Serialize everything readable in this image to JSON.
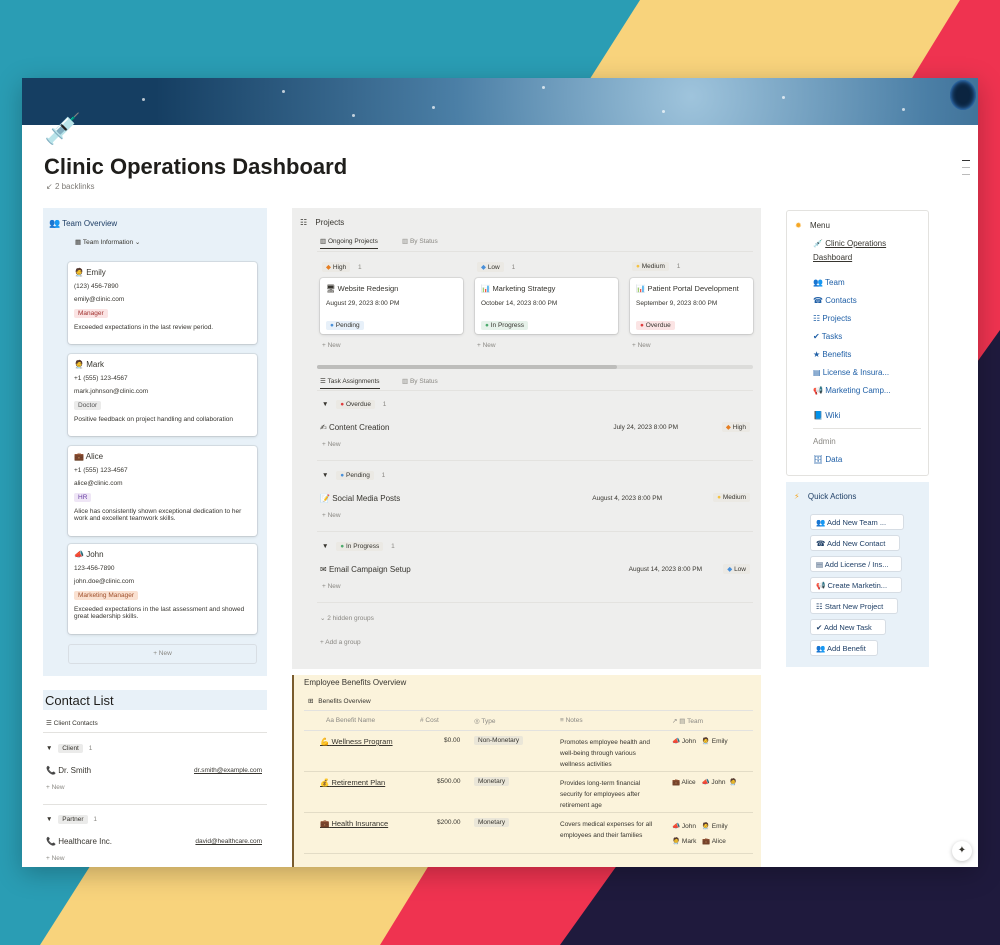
{
  "page": {
    "icon": "syringe",
    "title": "Clinic Operations Dashboard",
    "backlinks": "2 backlinks"
  },
  "team": {
    "header": "Team Overview",
    "view": "Team Information",
    "members": [
      {
        "name": "Emily",
        "phone": "(123) 456-7890",
        "email": "emily@clinic.com",
        "role": "Manager",
        "note": "Exceeded expectations in the last review period."
      },
      {
        "name": "Mark",
        "phone": "+1 (555) 123-4567",
        "email": "mark.johnson@clinic.com",
        "role": "Doctor",
        "note": "Positive feedback on project handling and collaboration"
      },
      {
        "name": "Alice",
        "phone": "+1 (555) 123-4567",
        "email": "alice@clinic.com",
        "role": "HR",
        "note": "Alice has consistently shown exceptional dedication to her work and excellent teamwork skills."
      },
      {
        "name": "John",
        "phone": "123-456-7890",
        "email": "john.doe@clinic.com",
        "role": "Marketing Manager",
        "note": "Exceeded expectations in the last assessment and showed great leadership skills."
      }
    ],
    "new_label": "+ New"
  },
  "contacts": {
    "title": "Contact List",
    "view": "Client Contacts",
    "groups": [
      {
        "name": "Client",
        "count": "1",
        "items": [
          {
            "name": "Dr. Smith",
            "email": "dr.smith@example.com"
          }
        ]
      },
      {
        "name": "Partner",
        "count": "1",
        "items": [
          {
            "name": "Healthcare Inc.",
            "email": "david@healthcare.com"
          }
        ]
      }
    ],
    "new_label": "+ New"
  },
  "projects": {
    "header": "Projects",
    "tab_active": "Ongoing Projects",
    "tab_other": "By Status",
    "columns": [
      {
        "label": "High",
        "count": "1",
        "color": "#e67e22",
        "card": {
          "name": "Website Redesign",
          "date": "August 29, 2023 8:00 PM",
          "status": "Pending"
        }
      },
      {
        "label": "Low",
        "count": "1",
        "color": "#4a90d9",
        "card": {
          "name": "Marketing Strategy",
          "date": "October 14, 2023 8:00 PM",
          "status": "In Progress"
        }
      },
      {
        "label": "Medium",
        "count": "1",
        "color": "#f5c242",
        "card": {
          "name": "Patient Portal Development",
          "date": "September 9, 2023 8:00 PM",
          "status": "Overdue"
        }
      }
    ],
    "new_label": "+ New"
  },
  "tasks": {
    "tab_active": "Task Assignments",
    "tab_other": "By Status",
    "groups": [
      {
        "status": "Overdue",
        "count": "1",
        "color": "#e03e3e",
        "task": "Content Creation",
        "date": "July 24, 2023 8:00 PM",
        "priority": "High"
      },
      {
        "status": "Pending",
        "count": "1",
        "color": "#4a90d9",
        "task": "Social Media Posts",
        "date": "August 4, 2023 8:00 PM",
        "priority": "Medium"
      },
      {
        "status": "In Progress",
        "count": "1",
        "color": "#4dab6d",
        "task": "Email Campaign Setup",
        "date": "August 14, 2023 8:00 PM",
        "priority": "Low"
      }
    ],
    "new_label": "+ New",
    "hidden_groups": "2 hidden groups",
    "add_group": "+ Add a group"
  },
  "benefits": {
    "title": "Employee Benefits Overview",
    "view": "Benefits Overview",
    "columns": [
      "Benefit Name",
      "Cost",
      "Type",
      "Notes",
      "Team"
    ],
    "rows": [
      {
        "name": "Wellness Program",
        "cost": "$0.00",
        "type": "Non-Monetary",
        "notes": "Promotes employee health and well-being through various wellness activities",
        "team": [
          "John",
          "Emily"
        ]
      },
      {
        "name": "Retirement Plan",
        "cost": "$500.00",
        "type": "Monetary",
        "notes": "Provides long-term financial security for employees after retirement age",
        "team": [
          "Alice",
          "John"
        ]
      },
      {
        "name": "Health Insurance",
        "cost": "$200.00",
        "type": "Monetary",
        "notes": "Covers medical expenses for all employees and their families",
        "team": [
          "John",
          "Emily",
          "Mark",
          "Alice"
        ]
      }
    ]
  },
  "menu": {
    "title": "Menu",
    "dashboard": "Clinic Operations Dashboard",
    "items": [
      "Team",
      "Contacts",
      "Projects",
      "Tasks",
      "Benefits",
      "License & Insura...",
      "Marketing Camp...",
      "Wiki"
    ],
    "admin_label": "Admin",
    "admin_items": [
      "Data"
    ]
  },
  "quick_actions": {
    "title": "Quick Actions",
    "buttons": [
      "Add New Team ...",
      "Add New Contact",
      "Add License / Ins...",
      "Create Marketin...",
      "Start New Project",
      "Add New Task",
      "Add Benefit"
    ]
  },
  "colors": {
    "accent": "#1f5fa6",
    "blue_panel": "#e8f1f8",
    "gray_panel": "#eeeeed",
    "yellow_panel": "#fbf3db"
  }
}
